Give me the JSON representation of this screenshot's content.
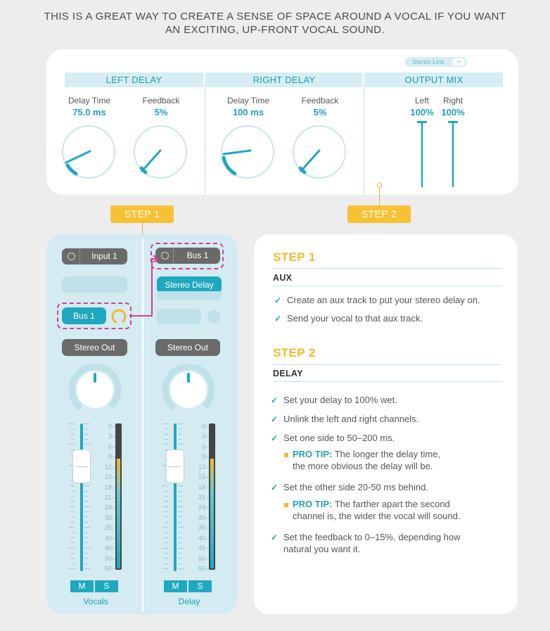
{
  "caption": {
    "line1": "THIS IS A GREAT WAY TO CREATE A SENSE OF SPACE AROUND A VOCAL IF YOU WANT",
    "line2": "AN EXCITING, UP-FRONT VOCAL SOUND."
  },
  "plugin": {
    "stereo_link_label": "Stereo Link",
    "stereo_link_icon": "link-icon",
    "left_delay": {
      "title": "LEFT DELAY",
      "delay_time_label": "Delay Time",
      "delay_time_value": "75.0 ms",
      "feedback_label": "Feedback",
      "feedback_value": "5%"
    },
    "right_delay": {
      "title": "RIGHT DELAY",
      "delay_time_label": "Delay Time",
      "delay_time_value": "100 ms",
      "feedback_label": "Feedback",
      "feedback_value": "5%"
    },
    "output_mix": {
      "title": "OUTPUT MIX",
      "left_label": "Left",
      "left_value": "100%",
      "right_label": "Right",
      "right_value": "100%",
      "left_level": 1.0,
      "right_level": 1.0
    }
  },
  "steps": {
    "step1_tag": "STEP 1",
    "step2_tag": "STEP 2"
  },
  "mixer": {
    "vocals": {
      "input_label": "Input 1",
      "send_label": "Bus 1",
      "output_label": "Stereo Out",
      "mute_label": "M",
      "solo_label": "S",
      "name": "Vocals",
      "meter_level": 0.78,
      "fader_level": 0.84
    },
    "delay": {
      "input_label": "Bus 1",
      "insert_label": "Stereo Delay",
      "output_label": "Stereo Out",
      "mute_label": "M",
      "solo_label": "S",
      "name": "Delay",
      "meter_level": 0.78,
      "fader_level": 0.84
    },
    "scale": [
      "0",
      "3",
      "6",
      "9",
      "12",
      "15",
      "18",
      "21",
      "24",
      "30",
      "35",
      "40",
      "45",
      "50",
      "60"
    ]
  },
  "instructions": {
    "step1": {
      "heading": "STEP 1",
      "subheading": "AUX",
      "items": [
        "Create an aux track to put your stereo delay on.",
        "Send your vocal to that aux track."
      ]
    },
    "step2": {
      "heading": "STEP 2",
      "subheading": "DELAY",
      "items": [
        "Set your delay to 100% wet.",
        "Unlink the left and right channels.",
        "Set one side to 50–200 ms.",
        "Set the other side 20-50 ms behind.",
        "Set the feedback to 0–15%, depending how"
      ],
      "item5_line2": "natural you want it.",
      "tip1_key": "PRO TIP:",
      "tip1_line1": "The longer the delay time,",
      "tip1_line2": "the more obvious the delay will be.",
      "tip2_key": "PRO TIP:",
      "tip2_line1": "The farther apart the second",
      "tip2_line2": "channel is, the wider the vocal will sound."
    }
  },
  "colors": {
    "accent": "#1fa8c0",
    "step_yellow": "#f8c135",
    "route_magenta": "#d43f8d"
  }
}
